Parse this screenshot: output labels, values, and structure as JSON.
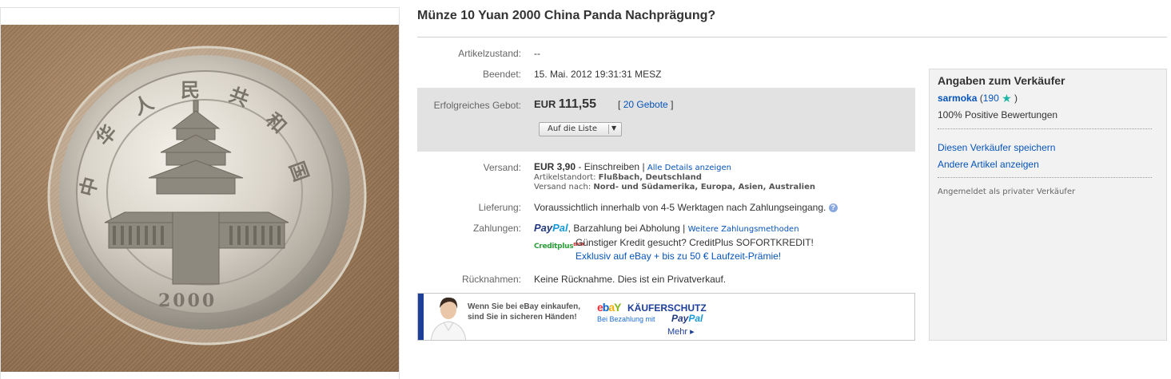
{
  "listing": {
    "title": "Münze 10 Yuan 2000 China Panda Nachprägung?"
  },
  "photo": {
    "coin_characters": [
      "中",
      "华",
      "人",
      "民",
      "共",
      "和",
      "国"
    ],
    "coin_year": "2000"
  },
  "details": {
    "condition_label": "Artikelzustand:",
    "condition_value": "--",
    "ended_label": "Beendet:",
    "ended_value": "15. Mai. 2012 19:31:31 MESZ"
  },
  "bid": {
    "label": "Erfolgreiches Gebot:",
    "currency": "EUR",
    "amount": "111,55",
    "bids_open": "[",
    "bids_link": "20 Gebote",
    "bids_close": "]",
    "watch_button": "Auf die Liste"
  },
  "shipping": {
    "label": "Versand:",
    "price": "EUR 3,90",
    "method": "- Einschreiben",
    "separator": "|",
    "details_link": "Alle Details anzeigen",
    "location_label": "Artikelstandort:",
    "location_value": "Flußbach, Deutschland",
    "ships_to_label": "Versand nach:",
    "ships_to_value": "Nord- und Südamerika, Europa, Asien, Australien"
  },
  "delivery": {
    "label": "Lieferung:",
    "value": "Voraussichtlich innerhalb von 4-5 Werktagen nach Zahlungseingang."
  },
  "payment": {
    "label": "Zahlungen:",
    "paypal_part1": "Pay",
    "paypal_part2": "Pal",
    "methods": ", Barzahlung bei Abholung |",
    "more_link": "Weitere Zahlungsmethoden",
    "creditplus_logo": "Creditplus",
    "creditplus_bank": "BANK",
    "credit_line1": "Günstiger Kredit gesucht? CreditPlus SOFORTKREDIT!",
    "credit_line2": "Exklusiv auf eBay + bis zu 50 € Laufzeit-Prämie!"
  },
  "returns": {
    "label": "Rücknahmen:",
    "value": "Keine Rücknahme. Dies ist ein Privatverkauf."
  },
  "banner": {
    "line1": "Wenn Sie bei eBay einkaufen,",
    "line2": "sind Sie in sicheren Händen!",
    "ebay_e": "e",
    "ebay_b": "b",
    "ebay_a": "a",
    "ebay_y": "Y",
    "protection": "KÄUFERSCHUTZ",
    "payment_note": "Bei Bezahlung mit",
    "paypal_part1": "Pay",
    "paypal_part2": "Pal",
    "more": "Mehr ▸"
  },
  "seller": {
    "heading": "Angaben zum Verkäufer",
    "name": "sarmoka",
    "feedback_open": "(",
    "feedback_score": "190",
    "feedback_close": ")",
    "positive": "100% Positive Bewertungen",
    "save_link": "Diesen Verkäufer speichern",
    "other_items_link": "Andere Artikel anzeigen",
    "seller_type": "Angemeldet als privater Verkäufer"
  },
  "colors": {
    "link": "#0654ba",
    "bid_box": "#e2e2e2",
    "seller_box": "#f2f2f2",
    "creditplus_green": "#2c9d3a"
  }
}
